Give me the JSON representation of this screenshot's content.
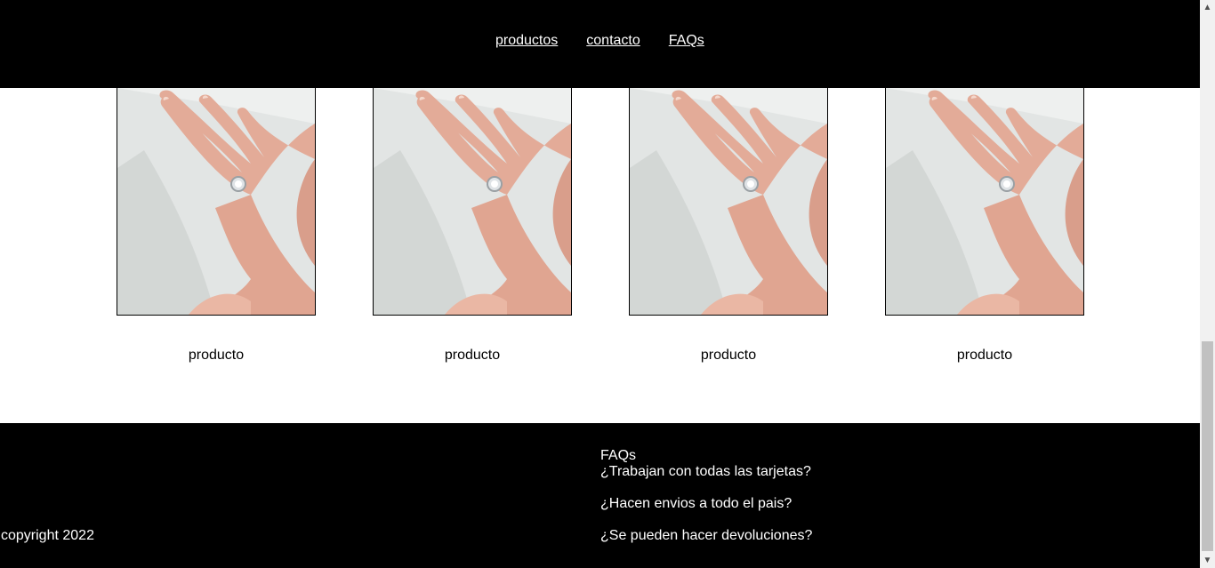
{
  "nav": {
    "items": [
      {
        "label": "productos"
      },
      {
        "label": "contacto"
      },
      {
        "label": "FAQs"
      }
    ]
  },
  "products": [
    {
      "name": "producto",
      "image": "hand-with-ring-photo"
    },
    {
      "name": "producto",
      "image": "hand-with-ring-photo"
    },
    {
      "name": "producto",
      "image": "hand-with-ring-photo"
    },
    {
      "name": "producto",
      "image": "hand-with-ring-photo"
    }
  ],
  "footer": {
    "copyright": "copyright 2022",
    "faq_title": "FAQs",
    "questions": [
      "¿Trabajan con todas las tarjetas?",
      "¿Hacen envios a todo el pais?",
      "¿Se pueden hacer devoluciones?"
    ]
  },
  "colors": {
    "header_bg": "#000000",
    "footer_bg": "#000000",
    "link": "#ffffff",
    "body_bg": "#ffffff"
  }
}
